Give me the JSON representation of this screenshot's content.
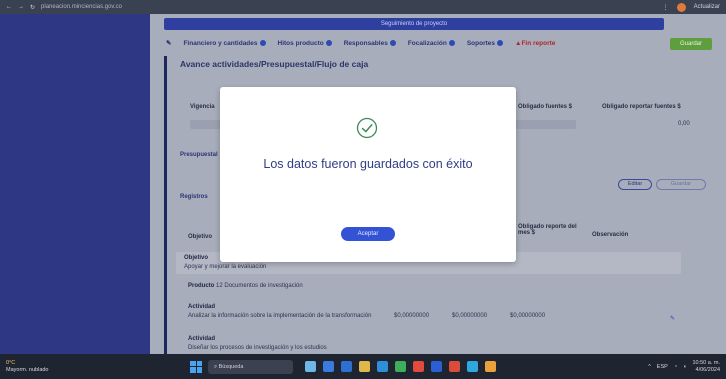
{
  "browser": {
    "url": "planeacion.minciencias.gov.co",
    "right_text": "Actualizar"
  },
  "header": {
    "banner": "Seguimiento de proyecto"
  },
  "tabs": [
    {
      "label": "Financiero y cantidades",
      "status": "ok"
    },
    {
      "label": "Hitos producto",
      "status": "ok"
    },
    {
      "label": "Responsables",
      "status": "ok"
    },
    {
      "label": "Focalización",
      "status": "ok"
    },
    {
      "label": "Soportes",
      "status": "ok"
    },
    {
      "label": "Fin reporte",
      "status": "warning"
    }
  ],
  "save_label": "Guardar",
  "section": {
    "title": "Avance actividades/Presupuestal/Flujo de caja",
    "col_left": "Vigencia",
    "col_right_1": "Obligado fuentes $",
    "col_right_2": "Obligado reportar fuentes $",
    "col_right_value": "0,00",
    "subtab_1": "Presupuestal",
    "subtab_2": "Registros",
    "pill_1": "Editar",
    "pill_2": "Guardar",
    "col_objetivo": "Objetivo",
    "col_obligado": "Obligado reporte del mes $",
    "col_observacion": "Observación",
    "row1_label": "Objetivo",
    "row1_text": "Apoyar y mejorar la evaluación",
    "product_label": "Producto",
    "product_text": "12 Documentos de investigación",
    "activity_label": "Actividad",
    "activity_text": "Analizar la información sobre la implementación de la transformación",
    "val_1": "$0,00000000",
    "val_2": "$0,00000000",
    "val_3": "$0,00000000",
    "activity2_label": "Actividad",
    "activity2_text": "Diseñar los procesos de investigación y los estudios"
  },
  "modal": {
    "message": "Los datos fueron guardados con éxito",
    "accept_label": "Aceptar"
  },
  "taskbar": {
    "temp": "0°C",
    "weather": "Mayorm. nublado",
    "search": "Búsqueda",
    "lang": "ESP",
    "clock_time": "10:50 a. m.",
    "clock_date": "4/06/2024"
  },
  "colors": {
    "sidebar": "#2d3784",
    "modal_text": "#2f3e86",
    "accept_button": "#3452d4",
    "success_icon": "#3a8a5a"
  }
}
